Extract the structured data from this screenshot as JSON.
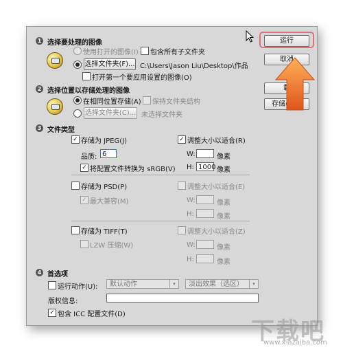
{
  "buttons": {
    "run": "运行",
    "cancel": "取消",
    "load": "载",
    "save": "存储(S)..."
  },
  "section1": {
    "title": "选择要处理的图像",
    "use_open": "使用打开的图像(I)",
    "include_sub": "包含所有子文件夹",
    "select_folder": "选择文件夹(F)...",
    "folder_path": "C:\\Users\\Jason Liu\\Desktop\\作品",
    "open_first": "打开第一个要应用设置的图像(O)"
  },
  "section2": {
    "title": "选择位置以存储处理的图像",
    "same_location": "在相同位置存储(A)",
    "keep_structure": "保持文件夹结构",
    "select_folder": "选择文件夹(C)...",
    "no_folder": "未选择文件夹"
  },
  "section3": {
    "title": "文件类型",
    "jpeg": {
      "save_as": "存储为 JPEG(J)",
      "quality_label": "品质:",
      "quality": "6",
      "convert": "将配置文件转换为 sRGB(V)",
      "resize": "调整大小以适合(R)",
      "w_label": "W:",
      "w_value": "",
      "h_label": "H:",
      "h_value": "1000",
      "unit": "像素"
    },
    "psd": {
      "save_as": "存储为 PSD(P)",
      "max_compat": "最大兼容(M)",
      "resize": "调整大小以适合(E)",
      "w_label": "W:",
      "h_label": "H:",
      "unit": "像素"
    },
    "tiff": {
      "save_as": "存储为 TIFF(T)",
      "lzw": "LZW 压缩(W)",
      "resize": "调整大小以适合(Z)",
      "w_label": "W:",
      "h_label": "H:",
      "unit": "像素"
    }
  },
  "section4": {
    "title": "首选项",
    "run_action": "运行动作(U):",
    "action_set": "默认动作",
    "action_name": "淡出效果（选区）",
    "copyright": "版权信息:",
    "icc": "包含 ICC 配置文件(D)"
  },
  "marks": {
    "check": "✓",
    "num1": "1",
    "num2": "2",
    "num3": "3",
    "num4": "4",
    "arrow_glyph": "▾"
  },
  "watermark": {
    "text": "下载吧",
    "sub": "www.xiazaiba.com"
  }
}
